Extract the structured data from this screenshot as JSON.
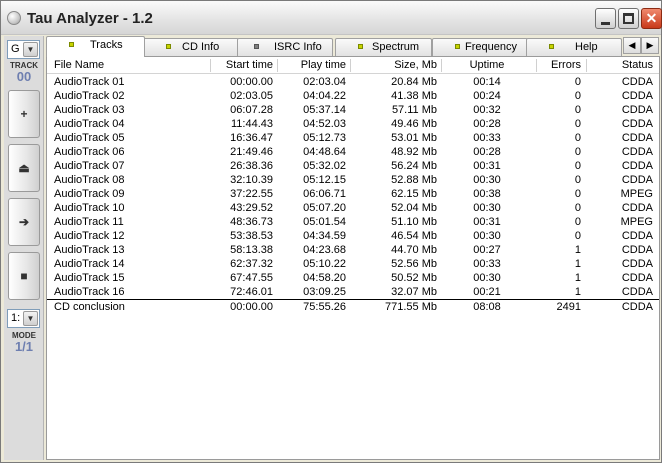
{
  "window": {
    "title": "Tau Analyzer - 1.2",
    "close_glyph": "✕"
  },
  "sidebar": {
    "track_combo_value": "G",
    "track_label": "TRACK",
    "track_value": "00",
    "buttons": [
      {
        "name": "add",
        "glyph": "+"
      },
      {
        "name": "eject",
        "glyph": "⏏"
      },
      {
        "name": "next",
        "glyph": "➔"
      },
      {
        "name": "stop",
        "glyph": "■"
      }
    ],
    "mode_combo_value": "1:",
    "mode_label": "MODE",
    "mode_value": "1/1"
  },
  "tabs": [
    {
      "label": "Tracks",
      "active": true,
      "led": "yellow"
    },
    {
      "label": "CD Info",
      "active": false,
      "led": "yellow"
    },
    {
      "label": "ISRC Info",
      "active": false,
      "led": "gray"
    },
    {
      "label": "Spectrum",
      "active": false,
      "led": "yellow"
    },
    {
      "label": "Frequency",
      "active": false,
      "led": "yellow"
    },
    {
      "label": "Help",
      "active": false,
      "led": "yellow"
    }
  ],
  "tab_scroll": {
    "left": "◀",
    "right": "▶"
  },
  "table": {
    "columns": [
      "File Name",
      "Start time",
      "Play time",
      "Size, Mb",
      "Uptime",
      "Errors",
      "Status"
    ],
    "rows": [
      [
        "AudioTrack 01",
        "00:00.00",
        "02:03.04",
        "20.84 Mb",
        "00:14",
        "0",
        "CDDA"
      ],
      [
        "AudioTrack 02",
        "02:03.05",
        "04:04.22",
        "41.38 Mb",
        "00:24",
        "0",
        "CDDA"
      ],
      [
        "AudioTrack 03",
        "06:07.28",
        "05:37.14",
        "57.11 Mb",
        "00:32",
        "0",
        "CDDA"
      ],
      [
        "AudioTrack 04",
        "11:44.43",
        "04:52.03",
        "49.46 Mb",
        "00:28",
        "0",
        "CDDA"
      ],
      [
        "AudioTrack 05",
        "16:36.47",
        "05:12.73",
        "53.01 Mb",
        "00:33",
        "0",
        "CDDA"
      ],
      [
        "AudioTrack 06",
        "21:49.46",
        "04:48.64",
        "48.92 Mb",
        "00:28",
        "0",
        "CDDA"
      ],
      [
        "AudioTrack 07",
        "26:38.36",
        "05:32.02",
        "56.24 Mb",
        "00:31",
        "0",
        "CDDA"
      ],
      [
        "AudioTrack 08",
        "32:10.39",
        "05:12.15",
        "52.88 Mb",
        "00:30",
        "0",
        "CDDA"
      ],
      [
        "AudioTrack 09",
        "37:22.55",
        "06:06.71",
        "62.15 Mb",
        "00:38",
        "0",
        "MPEG"
      ],
      [
        "AudioTrack 10",
        "43:29.52",
        "05:07.20",
        "52.04 Mb",
        "00:30",
        "0",
        "CDDA"
      ],
      [
        "AudioTrack 11",
        "48:36.73",
        "05:01.54",
        "51.10 Mb",
        "00:31",
        "0",
        "MPEG"
      ],
      [
        "AudioTrack 12",
        "53:38.53",
        "04:34.59",
        "46.54 Mb",
        "00:30",
        "0",
        "CDDA"
      ],
      [
        "AudioTrack 13",
        "58:13.38",
        "04:23.68",
        "44.70 Mb",
        "00:27",
        "1",
        "CDDA"
      ],
      [
        "AudioTrack 14",
        "62:37.32",
        "05:10.22",
        "52.56 Mb",
        "00:33",
        "1",
        "CDDA"
      ],
      [
        "AudioTrack 15",
        "67:47.55",
        "04:58.20",
        "50.52 Mb",
        "00:30",
        "1",
        "CDDA"
      ],
      [
        "AudioTrack 16",
        "72:46.01",
        "03:09.25",
        "32.07 Mb",
        "00:21",
        "1",
        "CDDA"
      ]
    ],
    "conclusion": [
      "CD conclusion",
      "00:00.00",
      "75:55.26",
      "771.55 Mb",
      "08:08",
      "2491",
      "CDDA"
    ]
  }
}
